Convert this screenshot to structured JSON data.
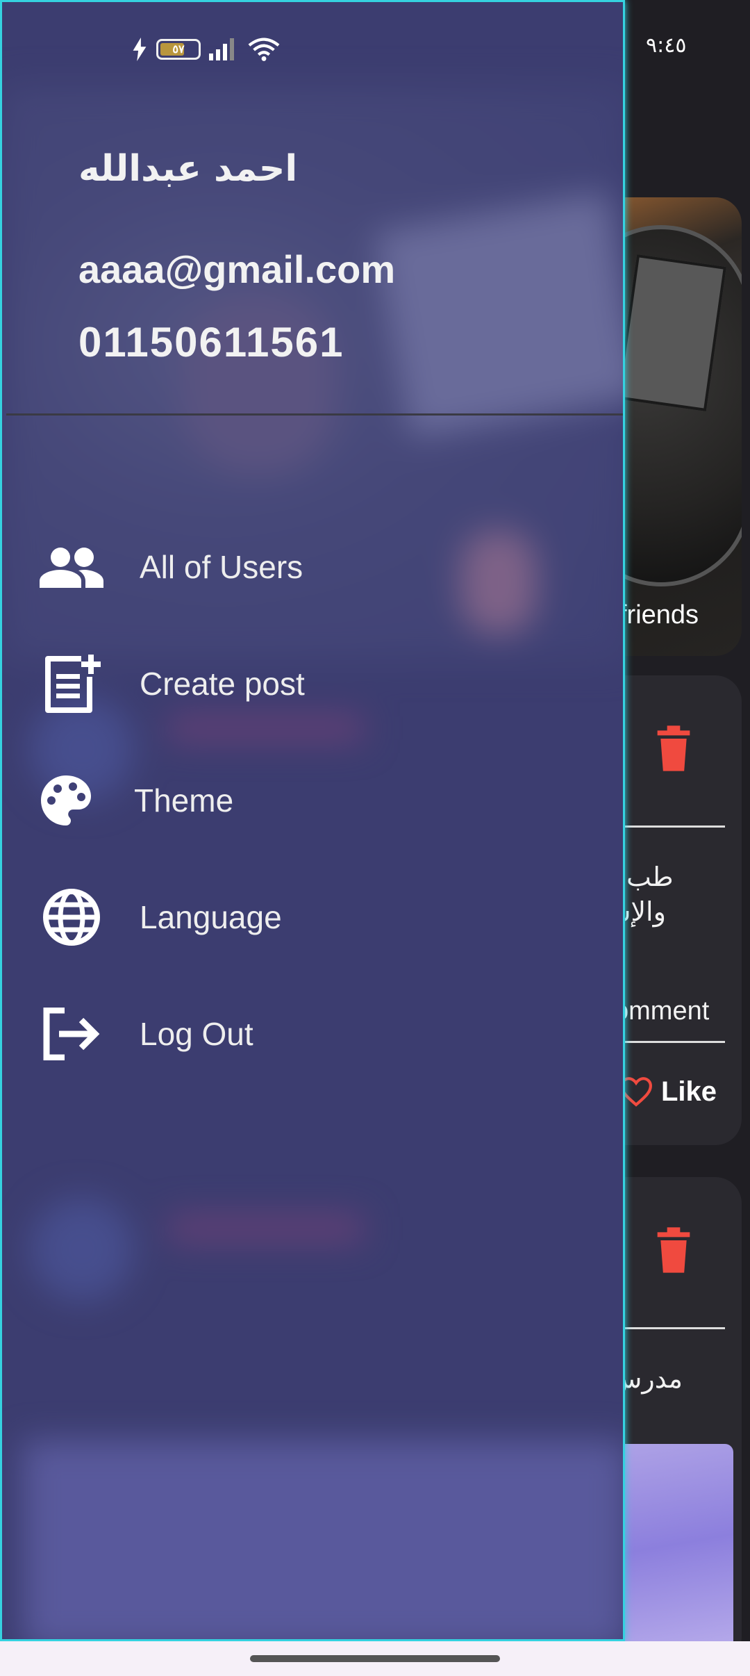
{
  "status_bar": {
    "time": "٩:٤٥",
    "battery": "٥٧"
  },
  "background_app": {
    "top_card_caption": "friends",
    "post1": {
      "text_line1": "طب",
      "text_line2": "والإس",
      "comment_label": "omment",
      "like_label": "Like"
    },
    "post2": {
      "text_line1": "مدرس"
    }
  },
  "drawer": {
    "user": {
      "name": "احمد عبدالله",
      "email": "aaaa@gmail.com",
      "phone": "01150611561"
    },
    "menu": [
      {
        "label": "All of Users",
        "icon": "group-icon"
      },
      {
        "label": "Create post",
        "icon": "post-add-icon"
      },
      {
        "label": "Theme",
        "icon": "palette-icon"
      },
      {
        "label": "Language",
        "icon": "globe-icon"
      },
      {
        "label": "Log Out",
        "icon": "logout-icon"
      }
    ]
  },
  "colors": {
    "accent_border": "#35d2e0",
    "trash": "#f04a3f",
    "like_heart": "#f04a3f"
  }
}
